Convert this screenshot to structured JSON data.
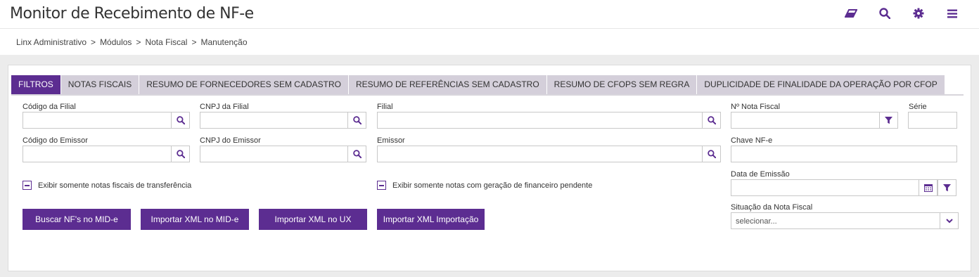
{
  "header": {
    "title": "Monitor de Recebimento de NF-e"
  },
  "top_icons": [
    "eraser-icon",
    "search-icon",
    "gear-icon",
    "menu-icon"
  ],
  "breadcrumb": [
    "Linx Administrativo",
    "Módulos",
    "Nota Fiscal",
    "Manutenção"
  ],
  "breadcrumb_sep": ">",
  "tabs": [
    "FILTROS",
    "NOTAS FISCAIS",
    "RESUMO DE FORNECEDORES SEM CADASTRO",
    "RESUMO DE REFERÊNCIAS SEM CADASTRO",
    "RESUMO DE CFOPS SEM REGRA",
    "DUPLICIDADE DE FINALIDADE DA OPERAÇÃO POR CFOP"
  ],
  "active_tab": "FILTROS",
  "filters": {
    "codigo_filial": "Código da Filial",
    "cnpj_filial": "CNPJ da Filial",
    "filial": "Filial",
    "nota_fiscal": "Nº Nota Fiscal",
    "serie": "Série",
    "codigo_emissor": "Código do Emissor",
    "cnpj_emissor": "CNPJ do Emissor",
    "emissor": "Emissor",
    "chave": "Chave NF-e",
    "data_emissao": "Data de Emissão",
    "situacao": "Situação da Nota Fiscal",
    "situacao_value": "selecionar..."
  },
  "checks": {
    "transferencia": "Exibir somente notas fiscais de transferência",
    "financeiro": "Exibir somente notas com geração de financeiro pendente"
  },
  "buttons": {
    "buscar": "Buscar NF's no MID-e",
    "importar_mid": "Importar XML no MID-e",
    "importar_ux": "Importar XML no UX",
    "importar_importacao": "Importar XML Importação"
  },
  "colors": {
    "accent": "#5c2d91",
    "tab_inactive": "#d4cfda"
  }
}
